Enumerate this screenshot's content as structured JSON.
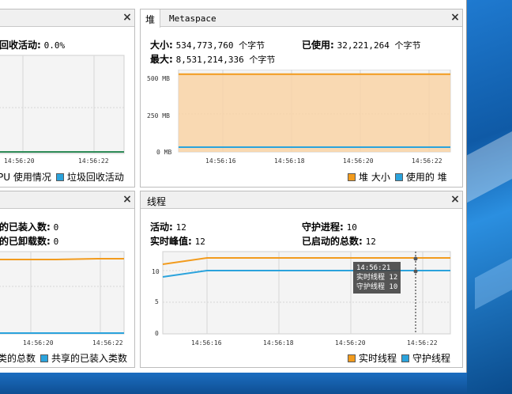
{
  "cpu_panel": {
    "stat_gc_label": "回收活动:",
    "stat_gc_value": "0.0%",
    "time_ticks": [
      "14:56:20",
      "14:56:22"
    ],
    "legend_cpu": "PU 使用情况",
    "legend_gc": "垃圾回收活动"
  },
  "heap_panel": {
    "tab_heap": "堆",
    "tab_metaspace": "Metaspace",
    "size_label": "大小:",
    "size_value": "534,773,760 个字节",
    "used_label": "已使用:",
    "used_value": "32,221,264 个字节",
    "max_label": "最大:",
    "max_value": "8,531,214,336 个字节",
    "y_ticks": [
      "500 MB",
      "250 MB",
      "0 MB"
    ],
    "time_ticks": [
      "14:56:16",
      "14:56:18",
      "14:56:20",
      "14:56:22"
    ],
    "legend_size": "堆 大小",
    "legend_used": "使用的 堆"
  },
  "classes_panel": {
    "loaded_label": "的已装入数:",
    "loaded_value": "0",
    "unloaded_label": "的已卸载数:",
    "unloaded_value": "0",
    "time_ticks": [
      "14:56:20",
      "14:56:22"
    ],
    "legend_total": "类的总数",
    "legend_shared": "共享的已装入类数"
  },
  "threads_panel": {
    "title": "线程",
    "live_label": "活动:",
    "live_value": "12",
    "peak_label": "实时峰值:",
    "peak_value": "12",
    "daemon_label": "守护进程:",
    "daemon_value": "10",
    "started_label": "已启动的总数:",
    "started_value": "12",
    "y_ticks": [
      "10",
      "5",
      "0"
    ],
    "time_ticks": [
      "14:56:16",
      "14:56:18",
      "14:56:20",
      "14:56:22"
    ],
    "tooltip_time": "14:56:21",
    "tooltip_live": "实时线程  12",
    "tooltip_daemon": "守护线程  10",
    "legend_live": "实时线程",
    "legend_daemon": "守护线程"
  },
  "colors": {
    "orange": "#f29b1d",
    "blue": "#2ba3dc"
  },
  "chart_data": [
    {
      "type": "area",
      "x": [
        "14:56:15",
        "14:56:16",
        "14:56:18",
        "14:56:20",
        "14:56:22",
        "14:56:23"
      ],
      "series": [
        {
          "name": "堆 大小",
          "values": [
            510,
            510,
            510,
            510,
            510,
            510
          ]
        },
        {
          "name": "使用的 堆",
          "values": [
            31,
            31,
            31,
            31,
            31,
            31
          ]
        }
      ],
      "ylim": [
        0,
        540
      ]
    },
    {
      "type": "line",
      "x": [
        "14:56:15",
        "14:56:16",
        "14:56:18",
        "14:56:20",
        "14:56:22",
        "14:56:23"
      ],
      "series": [
        {
          "name": "实时线程",
          "values": [
            11,
            12,
            12,
            12,
            12,
            12
          ]
        },
        {
          "name": "守护线程",
          "values": [
            9,
            10,
            10,
            10,
            10,
            10
          ]
        }
      ],
      "ylim": [
        0,
        13
      ]
    }
  ]
}
